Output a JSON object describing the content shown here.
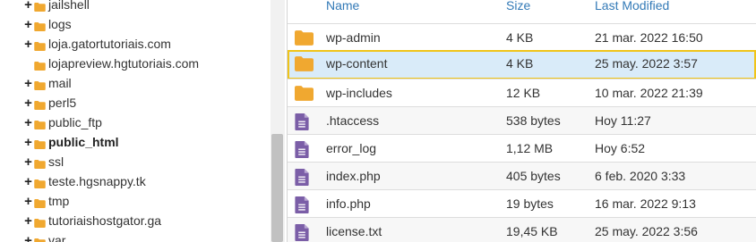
{
  "tree": {
    "items": [
      {
        "label": "jailshell",
        "plus": true,
        "bold": false
      },
      {
        "label": "logs",
        "plus": true,
        "bold": false
      },
      {
        "label": "loja.gatortutoriais.com",
        "plus": true,
        "bold": false
      },
      {
        "label": "lojapreview.hgtutoriais.com",
        "plus": false,
        "bold": false
      },
      {
        "label": "mail",
        "plus": true,
        "bold": false
      },
      {
        "label": "perl5",
        "plus": true,
        "bold": false
      },
      {
        "label": "public_ftp",
        "plus": true,
        "bold": false
      },
      {
        "label": "public_html",
        "plus": true,
        "bold": true
      },
      {
        "label": "ssl",
        "plus": true,
        "bold": false
      },
      {
        "label": "teste.hgsnappy.tk",
        "plus": true,
        "bold": false
      },
      {
        "label": "tmp",
        "plus": true,
        "bold": false
      },
      {
        "label": "tutoriaishostgator.ga",
        "plus": true,
        "bold": false
      },
      {
        "label": "var",
        "plus": true,
        "bold": false
      }
    ],
    "plus_symbol": "+",
    "folder_icon": "folder-icon",
    "folder_color": "#f0a830"
  },
  "table": {
    "headers": {
      "name": "Name",
      "size": "Size",
      "modified": "Last Modified"
    },
    "rows": [
      {
        "icon": "folder-icon",
        "name": "wp-admin",
        "size": "4 KB",
        "modified": "21 mar. 2022 16:50",
        "selected": false
      },
      {
        "icon": "folder-icon",
        "name": "wp-content",
        "size": "4 KB",
        "modified": "25 may. 2022 3:57",
        "selected": true
      },
      {
        "icon": "folder-icon",
        "name": "wp-includes",
        "size": "12 KB",
        "modified": "10 mar. 2022 21:39",
        "selected": false
      },
      {
        "icon": "file-icon",
        "name": ".htaccess",
        "size": "538 bytes",
        "modified": "Hoy 11:27",
        "selected": false
      },
      {
        "icon": "file-icon",
        "name": "error_log",
        "size": "1,12 MB",
        "modified": "Hoy 6:52",
        "selected": false
      },
      {
        "icon": "file-icon",
        "name": "index.php",
        "size": "405 bytes",
        "modified": "6 feb. 2020 3:33",
        "selected": false
      },
      {
        "icon": "file-icon",
        "name": "info.php",
        "size": "19 bytes",
        "modified": "16 mar. 2022 9:13",
        "selected": false
      },
      {
        "icon": "file-icon",
        "name": "license.txt",
        "size": "19,45 KB",
        "modified": "25 may. 2022 3:56",
        "selected": false
      }
    ]
  },
  "colors": {
    "header_link": "#337ab7",
    "selection_fill": "#d9ebf9",
    "selection_border": "#f0c419",
    "folder": "#f0a830",
    "file": "#7b5ea7"
  }
}
